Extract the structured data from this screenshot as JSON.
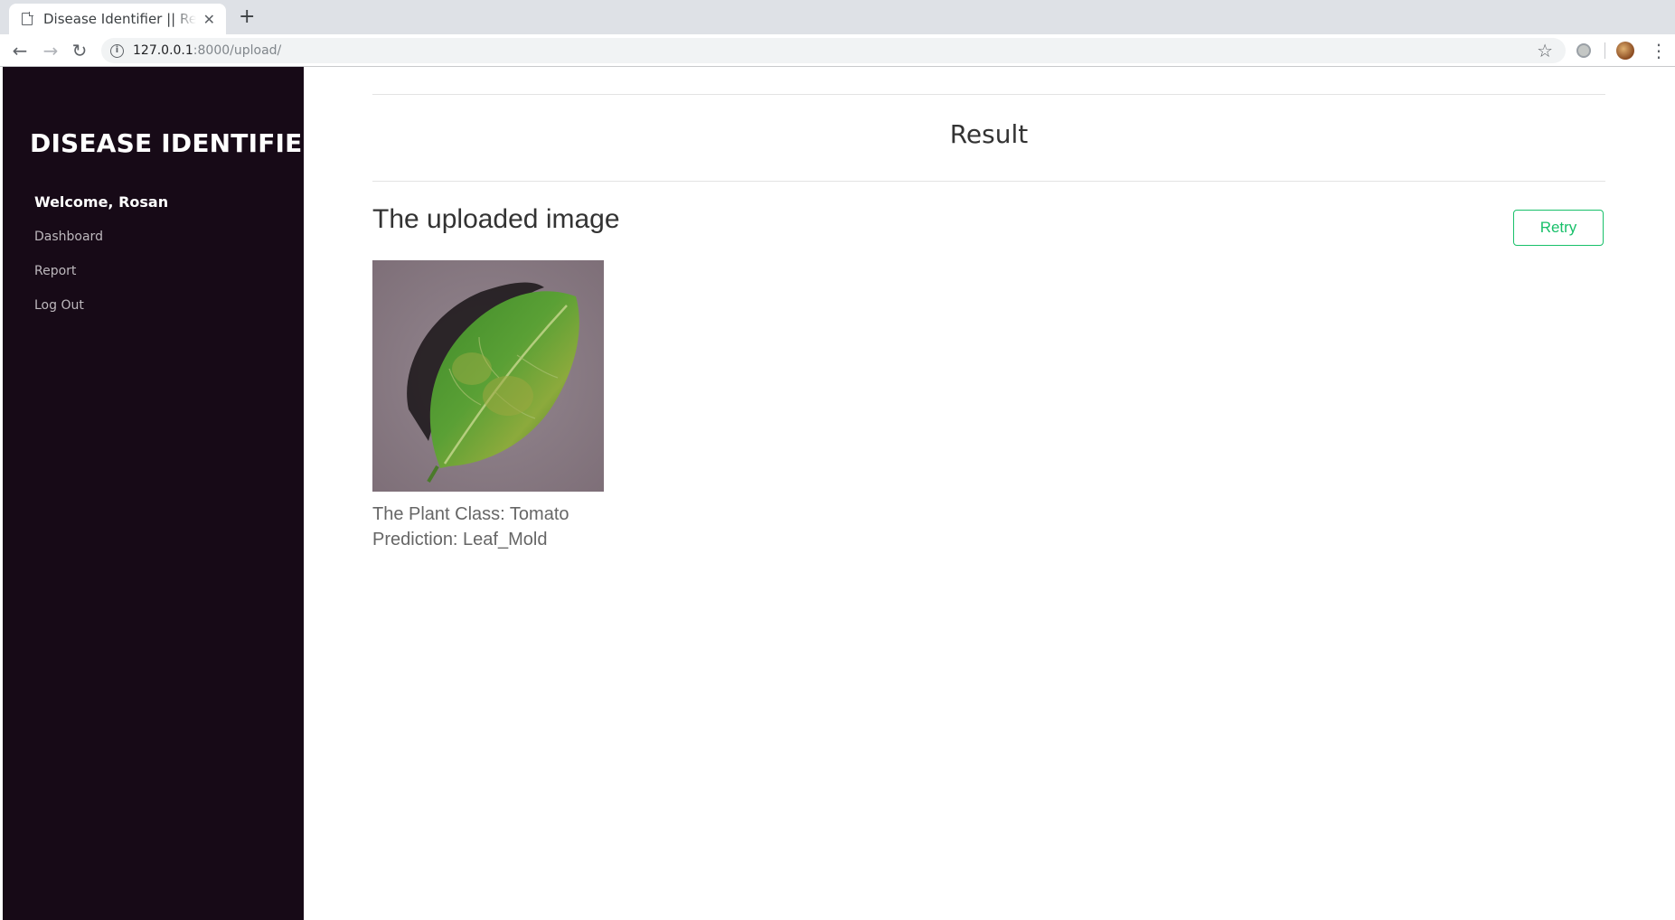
{
  "browser": {
    "tab_title": "Disease Identifier || Result",
    "url_host": "127.0.0.1",
    "url_path": ":8000/upload/"
  },
  "sidebar": {
    "brand": "DISEASE IDENTIFIER",
    "welcome": "Welcome, Rosan",
    "links": [
      {
        "label": "Dashboard"
      },
      {
        "label": "Report"
      },
      {
        "label": "Log Out"
      }
    ]
  },
  "main": {
    "title": "Result",
    "heading": "The uploaded image",
    "retry_label": "Retry",
    "plant_class": "The Plant Class: Tomato",
    "prediction": "Prediction: Leaf_Mold"
  },
  "colors": {
    "sidebar_bg": "#170a17",
    "accent_green": "#18c06a"
  },
  "icons": [
    "document-icon",
    "close-icon",
    "plus-icon",
    "back-icon",
    "forward-icon",
    "reload-icon",
    "info-icon",
    "star-icon",
    "extension-icon",
    "profile-icon",
    "menu-icon"
  ]
}
